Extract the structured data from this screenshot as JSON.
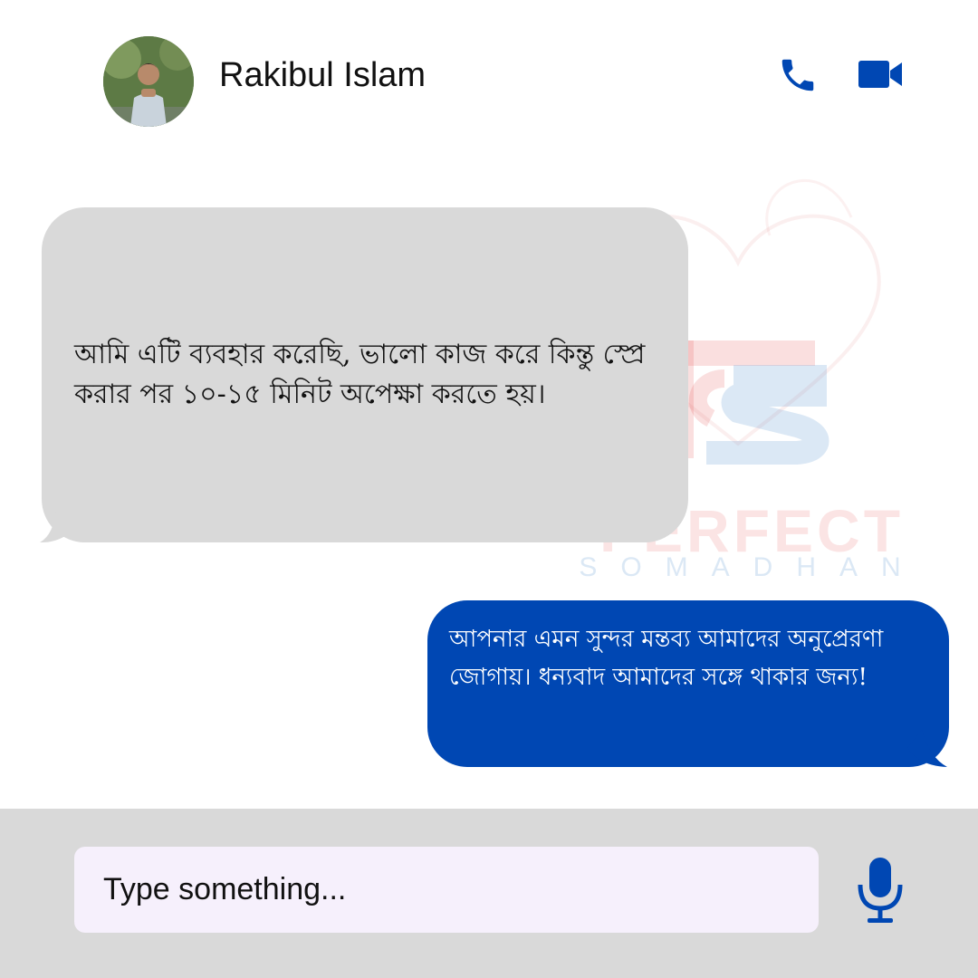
{
  "header": {
    "contact_name": "Rakibul Islam",
    "avatar_icon": "avatar-photo",
    "call_icon": "phone-icon",
    "video_icon": "video-camera-icon",
    "accent_color": "#0047b3"
  },
  "watermark": {
    "line1": "PERFECT",
    "line2": "SOMADHAN"
  },
  "messages": [
    {
      "direction": "incoming",
      "text": "আমি এটি ব্যবহার করেছি, ভালো কাজ করে কিন্তু স্প্রে করার পর ১০-১৫ মিনিট অপেক্ষা করতে হয়।",
      "bubble_color": "#d9d9d9"
    },
    {
      "direction": "outgoing",
      "text": "আপনার এমন সুন্দর মন্তব্য আমাদের অনুপ্রেরণা জোগায়। ধন্যবাদ আমাদের সঙ্গে থাকার জন্য!",
      "bubble_color": "#0047b3"
    }
  ],
  "composer": {
    "placeholder": "Type something...",
    "mic_icon": "microphone-icon"
  }
}
